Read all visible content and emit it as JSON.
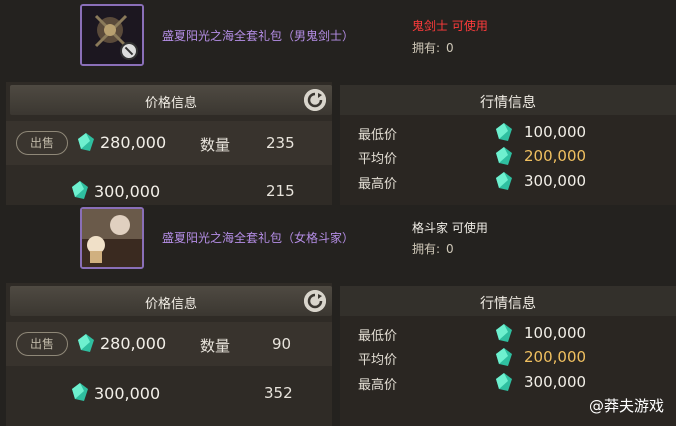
{
  "items": [
    {
      "name": "盛夏阳光之海全套礼包（男鬼剑士）",
      "usable_text": "鬼剑士 可使用",
      "usable_color": "#ff3b3b",
      "own_label": "拥有:",
      "own_count": "0",
      "price_panel": {
        "header": "价格信息",
        "sell_label": "出售",
        "rows": [
          {
            "price": "280,000",
            "qty_label": "数量",
            "qty": "235"
          },
          {
            "price": "300,000",
            "qty": "215"
          }
        ]
      },
      "market": {
        "header": "行情信息",
        "rows": [
          {
            "label": "最低价",
            "value": "100,000",
            "color": "#f2efe8"
          },
          {
            "label": "平均价",
            "value": "200,000",
            "color": "#f0c060"
          },
          {
            "label": "最高价",
            "value": "300,000",
            "color": "#f2efe8"
          }
        ]
      }
    },
    {
      "name": "盛夏阳光之海全套礼包（女格斗家）",
      "usable_text": "格斗家 可使用",
      "usable_color": "#f2efe8",
      "own_label": "拥有:",
      "own_count": "0",
      "price_panel": {
        "header": "价格信息",
        "sell_label": "出售",
        "rows": [
          {
            "price": "280,000",
            "qty_label": "数量",
            "qty": "90"
          },
          {
            "price": "300,000",
            "qty": "352"
          }
        ]
      },
      "market": {
        "header": "行情信息",
        "rows": [
          {
            "label": "最低价",
            "value": "100,000",
            "color": "#f2efe8"
          },
          {
            "label": "平均价",
            "value": "200,000",
            "color": "#f0c060"
          },
          {
            "label": "最高价",
            "value": "300,000",
            "color": "#f2efe8"
          }
        ]
      }
    }
  ],
  "icons": {
    "gem": "green-gem-icon",
    "refresh": "refresh-icon",
    "forbidden": "no-trade-icon"
  },
  "watermark": "@莽夫游戏"
}
